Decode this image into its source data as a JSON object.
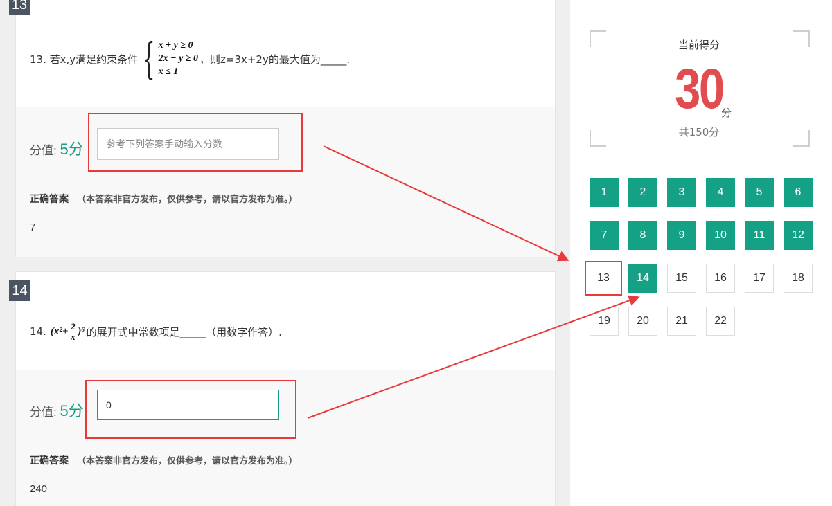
{
  "questions": [
    {
      "badge": "13",
      "text_prefix": "13. 若x,y满足约束条件",
      "constraints": [
        "x + y ≥ 0",
        "2x − y ≥ 0",
        "x ≤ 1"
      ],
      "text_suffix": "，则z=3x+2y的最大值为_____.",
      "score_label": "分值:",
      "score_value": "5",
      "score_unit": "分",
      "input_value": "",
      "input_placeholder": "参考下列答案手动输入分数",
      "answer_title": "正确答案",
      "answer_note": "（本答案非官方发布，仅供参考，请以官方发布为准。）",
      "answer": "7"
    },
    {
      "badge": "14",
      "text_prefix": "14.",
      "expr": {
        "base": "(x²+",
        "num": "2",
        "den": "x",
        "tail": ")⁶"
      },
      "text_suffix": "的展开式中常数项是_____（用数字作答）.",
      "score_label": "分值:",
      "score_value": "5",
      "score_unit": "分",
      "input_value": "0",
      "input_placeholder": "",
      "answer_title": "正确答案",
      "answer_note": "（本答案非官方发布，仅供参考，请以官方发布为准。）",
      "answer": "240"
    }
  ],
  "summary": {
    "label": "当前得分",
    "score": "30",
    "unit": "分",
    "total": "共150分"
  },
  "question_nav": {
    "items": [
      "1",
      "2",
      "3",
      "4",
      "5",
      "6",
      "7",
      "8",
      "9",
      "10",
      "11",
      "12",
      "13",
      "14",
      "15",
      "16",
      "17",
      "18",
      "19",
      "20",
      "21",
      "22"
    ],
    "done": [
      "1",
      "2",
      "3",
      "4",
      "5",
      "6",
      "7",
      "8",
      "9",
      "10",
      "11",
      "12",
      "14"
    ],
    "highlighted": "13"
  },
  "colors": {
    "accent_green": "#14a185",
    "score_red": "#e24c4f",
    "annotation_red": "#e8393b"
  }
}
